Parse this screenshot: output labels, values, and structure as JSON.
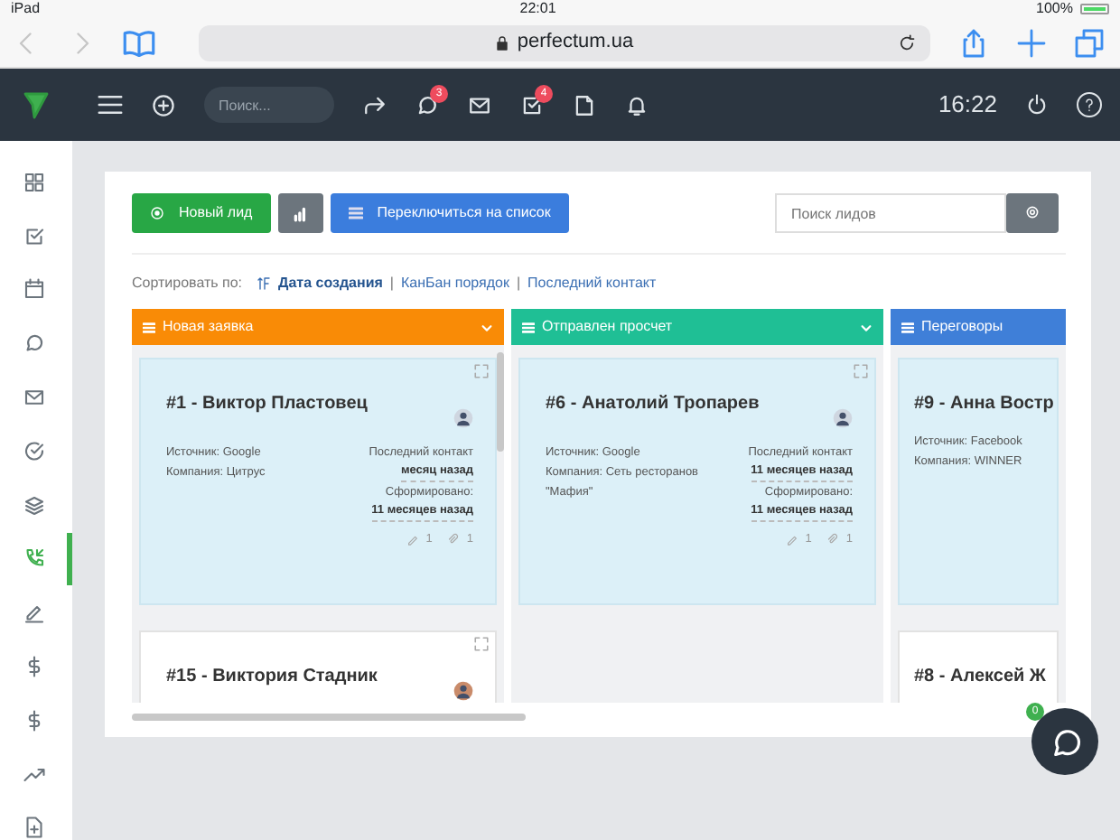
{
  "device": {
    "name": "iPad",
    "time": "22:01",
    "battery": "100%"
  },
  "browser": {
    "url": "perfectum.ua"
  },
  "header": {
    "search_placeholder": "Поиск...",
    "clock": "16:22",
    "icons": [
      {
        "kind": "forward"
      },
      {
        "kind": "chat",
        "badge": "3"
      },
      {
        "kind": "mail"
      },
      {
        "kind": "task",
        "badge": "4"
      },
      {
        "kind": "file"
      },
      {
        "kind": "bell"
      }
    ]
  },
  "sidebar": {
    "items": [
      {
        "kind": "grid",
        "selected": false
      },
      {
        "kind": "check-square",
        "selected": false
      },
      {
        "kind": "calendar",
        "selected": false
      },
      {
        "kind": "chat",
        "selected": false
      },
      {
        "kind": "mail",
        "selected": false
      },
      {
        "kind": "check-circle",
        "selected": false
      },
      {
        "kind": "layers",
        "selected": false
      },
      {
        "kind": "phone",
        "selected": true
      },
      {
        "kind": "pen",
        "selected": false
      },
      {
        "kind": "dollar",
        "selected": false
      },
      {
        "kind": "dollar",
        "selected": false
      },
      {
        "kind": "trend",
        "selected": false
      },
      {
        "kind": "file-plus",
        "selected": false
      }
    ]
  },
  "toolbar": {
    "buttons": [
      {
        "kind": "new",
        "label": "Новый лид"
      },
      {
        "kind": "chart"
      },
      {
        "kind": "list",
        "label": "Переключиться на список"
      }
    ],
    "search_placeholder": "Поиск лидов"
  },
  "sort": {
    "label": "Сортировать по:",
    "separator": "|",
    "options": [
      {
        "label": "Дата создания",
        "selected": true
      },
      {
        "label": "КанБан порядок",
        "selected": false
      },
      {
        "label": "Последний контакт",
        "selected": false
      }
    ]
  },
  "columns": [
    {
      "title": "Новая заявка",
      "color": "#f98b06",
      "dropdown": true,
      "cards": [
        {
          "title": "#1 - Виктор Пластовец",
          "highlighted": true,
          "source": "Источник: Google",
          "company": "Компания: Цитрус",
          "last_contact_label": "Последний контакт",
          "last_contact": "месяц назад",
          "formed_label": "Сформировано:",
          "formed": "11 месяцев назад",
          "notes": "1",
          "files": "1"
        },
        {
          "title": "#15 - Виктория Стадник",
          "highlighted": false
        }
      ]
    },
    {
      "title": "Отправлен просчет",
      "color": "#1fbf95",
      "dropdown": true,
      "cards": [
        {
          "title": "#6 - Анатолий Тропарев",
          "highlighted": true,
          "source": "Источник: Google",
          "company": "Компания: Сеть ресторанов \"Мафия\"",
          "last_contact_label": "Последний контакт",
          "last_contact": "11 месяцев назад",
          "formed_label": "Сформировано:",
          "formed": "11 месяцев назад",
          "notes": "1",
          "files": "1"
        }
      ]
    },
    {
      "title": "Переговоры",
      "color": "#3f7fd8",
      "dropdown": false,
      "cards": [
        {
          "title": "#9 - Анна Востр",
          "highlighted": true,
          "source": "Источник: Facebook",
          "company": "Компания: WINNER"
        },
        {
          "title": "#8 - Алексей Ж",
          "highlighted": false
        }
      ]
    }
  ],
  "chat": {
    "badge": "0"
  }
}
